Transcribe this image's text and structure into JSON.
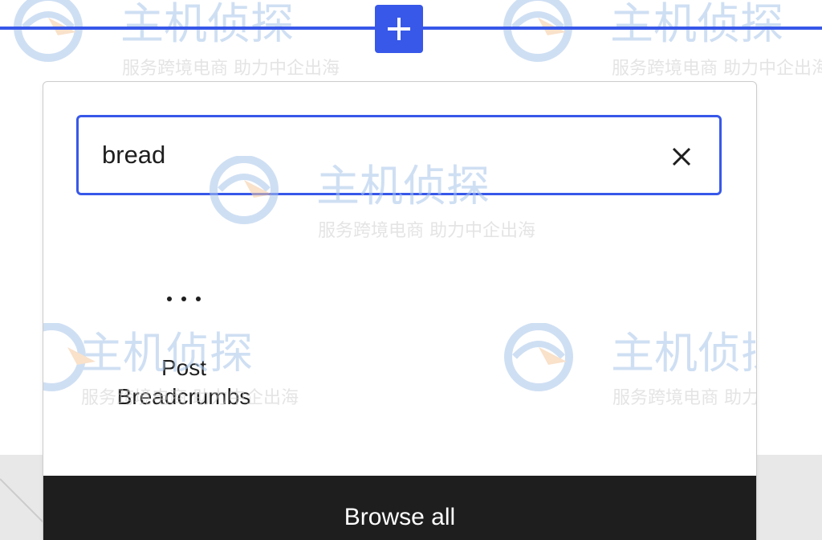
{
  "inserter": {
    "plus_icon": "plus-icon"
  },
  "search": {
    "value": "bread",
    "clear_icon": "close-icon"
  },
  "results": {
    "items": [
      {
        "label": "Post\nBreadcrumbs",
        "label_line1": "Post",
        "label_line2": "Breadcrumbs",
        "icon": "more-horizontal-icon"
      }
    ]
  },
  "browse_all": {
    "label": "Browse all"
  },
  "watermark": {
    "brand": "主机侦探",
    "slogan": "服务跨境电商 助力中企出海"
  },
  "colors": {
    "accent": "#3858e9",
    "dark": "#1e1e1e",
    "watermark_blue": "#a9c6ea",
    "watermark_orange": "#f5c9a0"
  }
}
